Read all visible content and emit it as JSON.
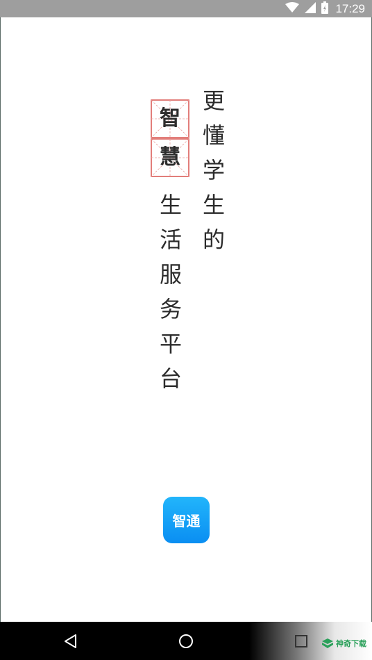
{
  "status_bar": {
    "time": "17:29",
    "icons": [
      "wifi-icon",
      "cell-signal-icon",
      "battery-icon"
    ]
  },
  "splash": {
    "tagline_right": [
      "更",
      "懂",
      "学",
      "生",
      "的"
    ],
    "highlight_chars": [
      "智",
      "慧"
    ],
    "tagline_left": [
      "生",
      "活",
      "服",
      "务",
      "平",
      "台"
    ],
    "app_logo_text": "智通"
  },
  "nav_bar": {
    "buttons": [
      "back-icon",
      "home-icon",
      "recents-icon"
    ]
  },
  "watermark": {
    "text": "神奇下载"
  },
  "colors": {
    "status_bar_bg": "#9e9e9e",
    "logo_blue": "#1aa3f8",
    "grid_red": "#d9534f"
  }
}
